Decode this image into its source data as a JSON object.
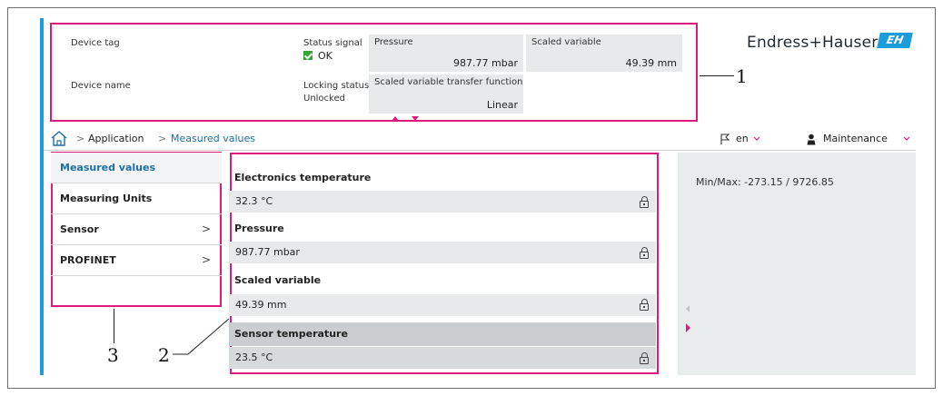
{
  "header": {
    "device_tag_label": "Device tag",
    "device_name_label": "Device name",
    "status_signal_label": "Status signal",
    "status_signal_value": "OK",
    "locking_status_label": "Locking status",
    "locking_status_value": "Unlocked",
    "tiles": [
      {
        "label": "Pressure",
        "value": "987.77 mbar"
      },
      {
        "label": "Scaled variable",
        "value": "49.39 mm"
      },
      {
        "label": "Scaled variable transfer function",
        "value": "Linear"
      }
    ],
    "brand": "Endress+Hauser",
    "logo_text": "EH"
  },
  "breadcrumb": {
    "items": [
      "Application",
      "Measured values"
    ],
    "separator": ">",
    "language": "en",
    "user_role": "Maintenance"
  },
  "nav": {
    "items": [
      {
        "label": "Measured values",
        "has_submenu": false,
        "active": true
      },
      {
        "label": "Measuring Units",
        "has_submenu": false,
        "active": false
      },
      {
        "label": "Sensor",
        "has_submenu": true,
        "active": false
      },
      {
        "label": "PROFINET",
        "has_submenu": true,
        "active": false
      }
    ],
    "chevron": ">"
  },
  "params": [
    {
      "label": "Electronics temperature",
      "value": "32.3 °C"
    },
    {
      "label": "Pressure",
      "value": "987.77 mbar"
    },
    {
      "label": "Scaled variable",
      "value": "49.39 mm"
    },
    {
      "label": "Sensor temperature",
      "value": "23.5 °C"
    }
  ],
  "right_panel": {
    "minmax": "Min/Max: -273.15 / 9726.85"
  },
  "callouts": [
    "1",
    "2",
    "3"
  ],
  "colors": {
    "accent": "#1c9cd8",
    "highlight": "#e0197d",
    "status_ok": "#2fa832",
    "tile_bg": "#e7e9ea",
    "panel_bg": "#e9eced",
    "link": "#1c6fa8"
  },
  "icons": {
    "home": "home-icon",
    "lock": "lock-icon",
    "flag": "flag-icon",
    "user": "user-icon"
  }
}
